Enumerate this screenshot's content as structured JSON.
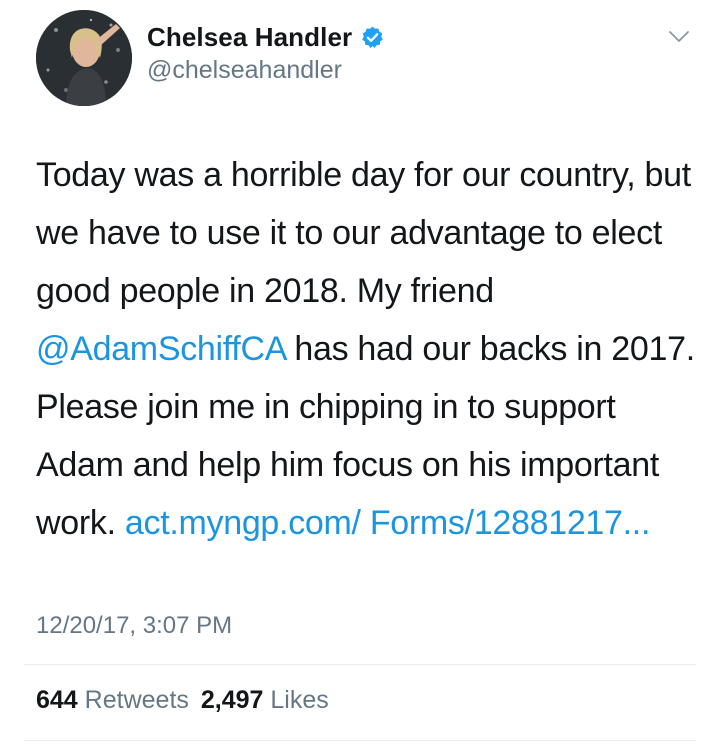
{
  "tweet": {
    "author": {
      "display_name": "Chelsea Handler",
      "handle": "@chelseahandler",
      "verified": true,
      "avatar_icon": "profile-photo"
    },
    "menu_icon": "chevron-down-icon",
    "text": {
      "part1": "Today was a horrible day for our country, but we have to use it to our advantage to elect good people in 2018. My friend ",
      "mention": "@AdamSchiffCA",
      "part2": " has had our backs in 2017. Please join me in chipping in to support Adam and help him focus on his important work. ",
      "link": "act.myngp.com/ Forms/12881217..."
    },
    "timestamp": "12/20/17, 3:07 PM",
    "stats": {
      "retweets_count": "644",
      "retweets_label": "Retweets",
      "likes_count": "2,497",
      "likes_label": "Likes"
    }
  },
  "colors": {
    "link": "#1b95e0",
    "secondary_text": "#657786",
    "primary_text": "#14171a",
    "verified": "#1da1f2"
  }
}
